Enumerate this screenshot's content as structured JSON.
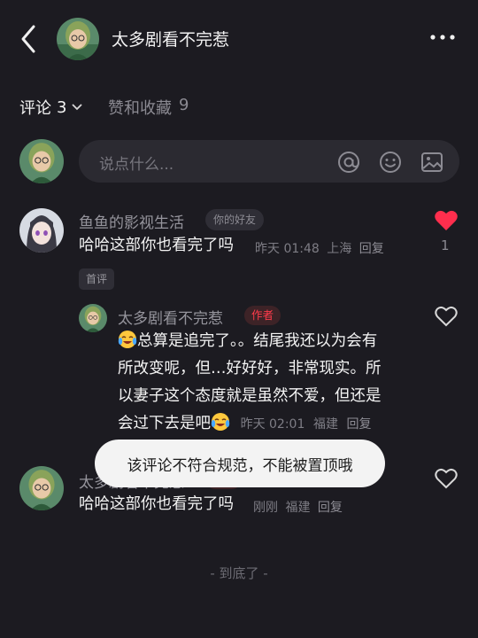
{
  "header": {
    "title": "太多剧看不完惹",
    "back_icon": "chevron-left-icon",
    "more_icon": "more-horizontal-icon"
  },
  "tabs": {
    "comments_label": "评论",
    "comments_count": "3",
    "likes_label": "赞和收藏",
    "likes_count": "9"
  },
  "input": {
    "placeholder": "说点什么..."
  },
  "comments": [
    {
      "author": "鱼鱼的影视生活",
      "badge": "你的好友",
      "text": "哈哈这部你也看完了吗",
      "time": "昨天 01:48",
      "location": "上海",
      "reply_label": "回复",
      "likes": "1",
      "liked": true,
      "tag": "首评"
    },
    {
      "author": "太多剧看不完惹",
      "badge": "作者",
      "text_parts": [
        "总算是追完了。。结尾我还以为会有",
        "所改变呢，但…好好好，非常现实。所",
        "以妻子这个态度就是虽然不爱，但还是",
        "会过下去是吧"
      ],
      "time": "昨天 02:01",
      "location": "福建",
      "reply_label": "回复"
    },
    {
      "author": "太多剧看不完惹",
      "badge": "作者",
      "text": "哈哈这部你也看完了吗",
      "time": "刚刚",
      "location": "福建",
      "reply_label": "回复"
    }
  ],
  "toast": "该评论不符合规范，不能被置顶哦",
  "footer": "- 到底了 -",
  "colors": {
    "background": "#1c1b21",
    "like_red": "#ff2e4d",
    "author_badge": "#ff3b4b"
  }
}
